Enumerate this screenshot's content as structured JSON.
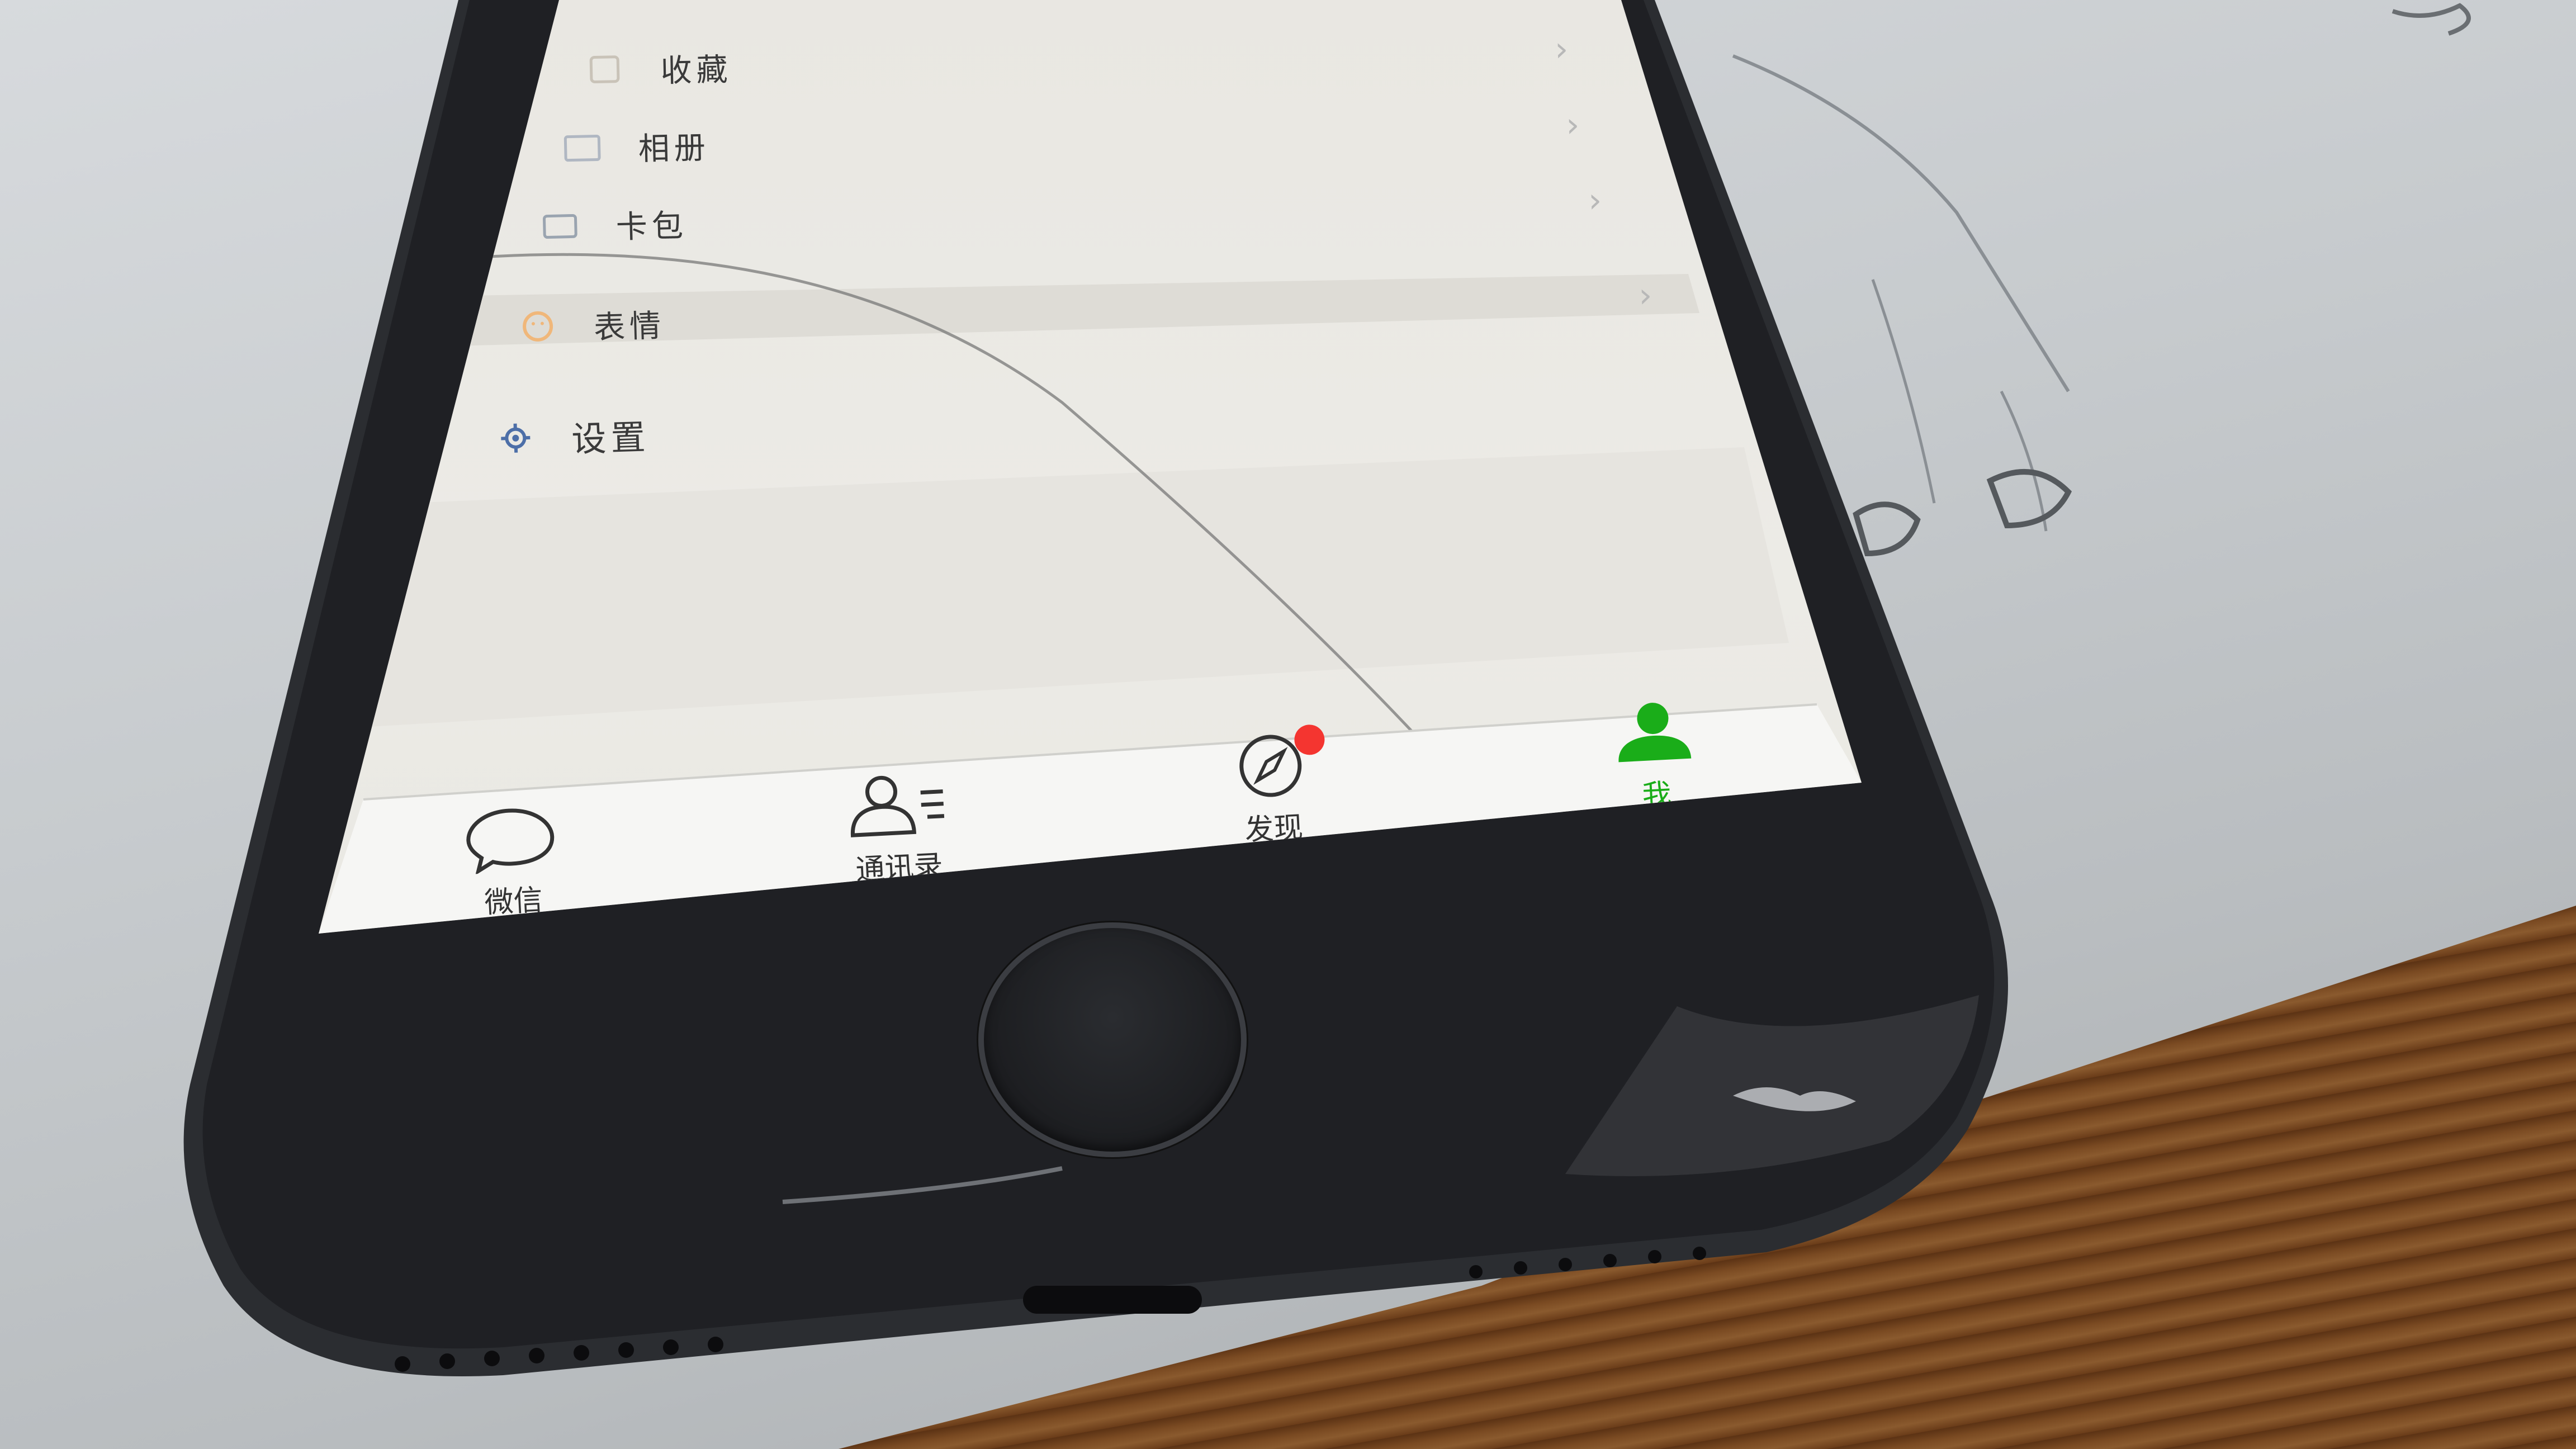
{
  "menu": {
    "items": [
      {
        "label": "收藏",
        "icon": "cube-icon"
      },
      {
        "label": "相册",
        "icon": "photo-icon"
      },
      {
        "label": "卡包",
        "icon": "card-icon"
      },
      {
        "label": "表情",
        "icon": "smile-icon"
      },
      {
        "label": "设置",
        "icon": "gear-icon"
      }
    ]
  },
  "tabbar": {
    "tabs": [
      {
        "label": "微信",
        "icon": "chat-bubble-icon",
        "active": false
      },
      {
        "label": "通讯录",
        "icon": "contacts-icon",
        "active": false
      },
      {
        "label": "发现",
        "icon": "compass-icon",
        "active": false,
        "badge": true
      },
      {
        "label": "我",
        "icon": "person-icon",
        "active": true
      }
    ]
  },
  "colors": {
    "accent": "#1aad19",
    "badge": "#f43530"
  }
}
